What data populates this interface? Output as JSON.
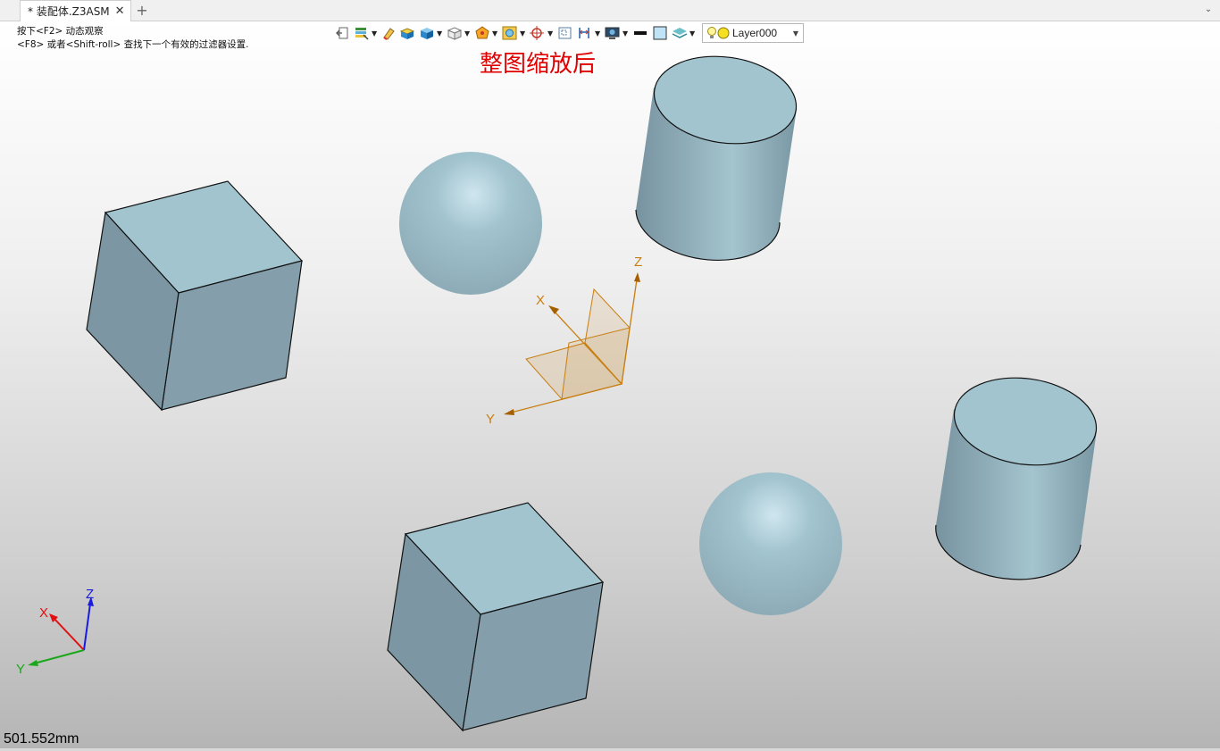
{
  "tab": {
    "title": "* 装配体.Z3ASM",
    "close_glyph": "✕",
    "add_glyph": "+",
    "menu_glyph": "⌄"
  },
  "hints": {
    "line1": "按下<F2> 动态观察",
    "line2": "<F8> 或者<Shift-roll> 查找下一个有效的过滤器设置."
  },
  "toolbar": {
    "icons": [
      "exit-icon",
      "filter-icon",
      "eraser-icon",
      "shade-icon",
      "render-mode-icon",
      "view-cube-icon",
      "orient-icon",
      "zoom-fit-icon",
      "target-icon",
      "frame-icon",
      "dimension-icon",
      "screen-icon",
      "line-color-icon",
      "face-color-icon",
      "layer-icon"
    ],
    "layer": {
      "name": "Layer000"
    }
  },
  "banner": "整图缩放后",
  "datum_axes": {
    "x": "X",
    "y": "Y",
    "z": "Z"
  },
  "triad_axes": {
    "x": "X",
    "y": "Y",
    "z": "Z"
  },
  "colors": {
    "solid_face_light": "#a2c4cf",
    "solid_face_mid": "#8eacb6",
    "solid_face_dark": "#7894a0",
    "datum": "#c87f12",
    "triad_x": "#e01010",
    "triad_y": "#1aa81a",
    "triad_z": "#1a1ae0",
    "banner": "#e00000"
  },
  "status": {
    "scale": "501.552mm"
  }
}
